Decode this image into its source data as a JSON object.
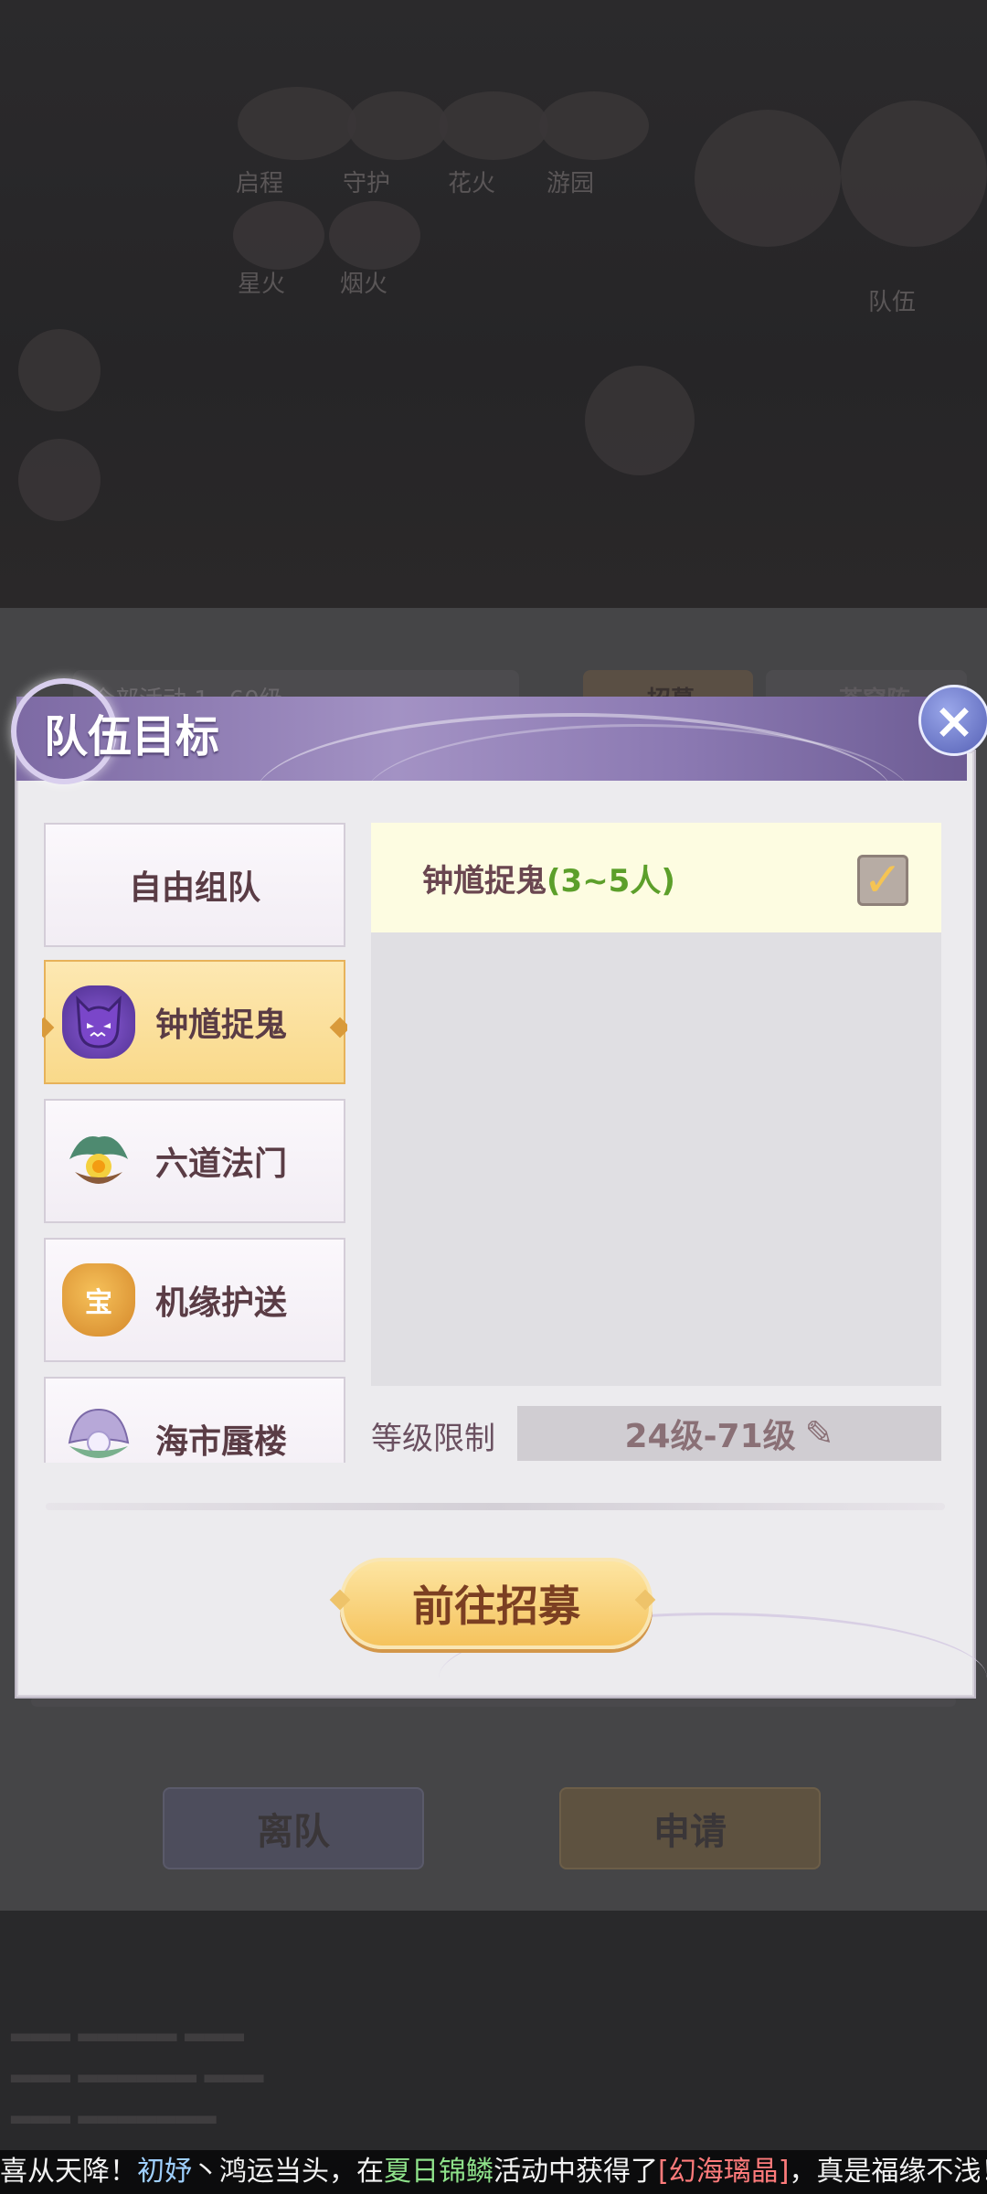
{
  "dialog": {
    "title": "队伍目标",
    "close_icon": "×"
  },
  "categories": [
    {
      "label": "自由组队",
      "icon": ""
    },
    {
      "label": "钟馗捉鬼",
      "icon": "ghost",
      "active": true
    },
    {
      "label": "六道法门",
      "icon": "shell"
    },
    {
      "label": "机缘护送",
      "icon": "宝"
    },
    {
      "label": "海市蜃楼",
      "icon": "pearl-shell"
    }
  ],
  "target": {
    "name": "钟馗捉鬼",
    "size": "(3~5人)",
    "checked": true,
    "check_glyph": "✓"
  },
  "level": {
    "label": "等级限制",
    "value": "24级-71级",
    "edit_glyph": "✎"
  },
  "recruit_button": "前往招募",
  "background": {
    "filter_text": "全部活动 1~60级",
    "recruit_small": "招募",
    "team_name": "苍穹阵",
    "leave_button": "离队",
    "apply_button": "申请",
    "top_labels": [
      "启程",
      "守护",
      "花火",
      "游园",
      "星火",
      "烟火",
      "队伍"
    ]
  },
  "marquee": {
    "prefix": "喜从天降！",
    "player": "初妤",
    "mid": "丶鸿运当头，在",
    "event": "夏日锦鳞",
    "mid2": "活动中获得了",
    "item": "[幻海璃晶]",
    "suffix": "，真是福缘不浅！"
  },
  "colors": {
    "accent_gold": "#f5c35d",
    "active_item": "#f9d98a",
    "title_purple": "#8b79b2",
    "target_row": "#fdfce1",
    "team_size_green": "#5c9f2a"
  }
}
